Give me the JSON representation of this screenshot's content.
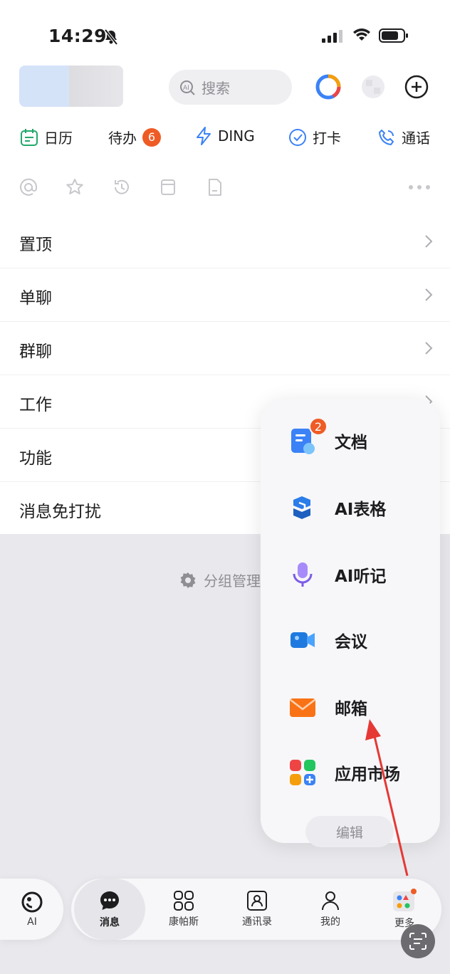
{
  "status_bar": {
    "time": "14:29"
  },
  "header": {
    "search_placeholder": "搜索",
    "ai_badge": "AI"
  },
  "shortcuts": [
    {
      "label": "日历",
      "icon": "calendar-icon"
    },
    {
      "label": "待办",
      "badge": "6",
      "icon": ""
    },
    {
      "label": "DING",
      "icon": "lightning-icon"
    },
    {
      "label": "打卡",
      "icon": "check-circle-icon"
    },
    {
      "label": "通话",
      "icon": "phone-icon"
    }
  ],
  "quick_icons": [
    "at-icon",
    "star-icon",
    "history-icon",
    "archive-icon",
    "file-icon",
    "more-icon"
  ],
  "list": [
    {
      "label": "置顶"
    },
    {
      "label": "单聊"
    },
    {
      "label": "群聊"
    },
    {
      "label": "工作"
    },
    {
      "label": "功能"
    },
    {
      "label": "消息免打扰"
    }
  ],
  "group_manage": "分组管理",
  "popup": {
    "items": [
      {
        "label": "文档",
        "badge": "2",
        "icon": "document-icon"
      },
      {
        "label": "AI表格",
        "icon": "ai-table-icon"
      },
      {
        "label": "AI听记",
        "icon": "microphone-icon"
      },
      {
        "label": "会议",
        "icon": "video-icon"
      },
      {
        "label": "邮箱",
        "icon": "mail-icon"
      },
      {
        "label": "应用市场",
        "icon": "app-market-icon"
      }
    ],
    "edit_label": "编辑"
  },
  "tabbar": {
    "ai_label": "AI",
    "tabs": [
      {
        "label": "消息",
        "icon": "chat-icon",
        "active": true
      },
      {
        "label": "康帕斯",
        "icon": "grid-icon"
      },
      {
        "label": "通讯录",
        "icon": "contacts-icon"
      },
      {
        "label": "我的",
        "icon": "person-icon"
      },
      {
        "label": "更多",
        "icon": "more-apps-icon"
      }
    ]
  },
  "colors": {
    "accent_badge": "#ef5b25",
    "brand_blue": "#3b82f6",
    "green": "#22a86b"
  }
}
